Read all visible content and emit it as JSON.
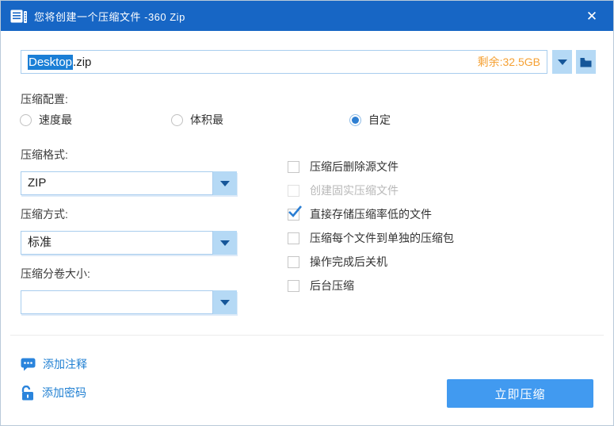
{
  "window": {
    "title": "您将创建一个压缩文件 -360 Zip",
    "close_glyph": "✕"
  },
  "filename": {
    "selected_part": "Desktop",
    "extension_part": ".zip",
    "free_space": "剩余:32.5GB"
  },
  "config": {
    "label": "压缩配置:",
    "options": [
      {
        "label": "速度最",
        "selected": false
      },
      {
        "label": "体积最",
        "selected": false
      },
      {
        "label": "自定",
        "selected": true
      }
    ]
  },
  "fields": [
    {
      "label": "压缩格式:",
      "value": "ZIP"
    },
    {
      "label": "压缩方式:",
      "value": "标准"
    },
    {
      "label": "压缩分卷大小:",
      "value": ""
    }
  ],
  "checkboxes": [
    {
      "label": "压缩后删除源文件",
      "checked": false,
      "disabled": false
    },
    {
      "label": "创建固实压缩文件",
      "checked": false,
      "disabled": true
    },
    {
      "label": "直接存储压缩率低的文件",
      "checked": true,
      "disabled": false
    },
    {
      "label": "压缩每个文件到单独的压缩包",
      "checked": false,
      "disabled": false
    },
    {
      "label": "操作完成后关机",
      "checked": false,
      "disabled": false
    },
    {
      "label": "后台压缩",
      "checked": false,
      "disabled": false
    }
  ],
  "footer": {
    "add_comment_label": "添加注释",
    "add_password_label": "添加密码",
    "compress_button_label": "立即压缩"
  },
  "colors": {
    "titlebar": "#1766c5",
    "selection": "#1b7fd6",
    "free_space_text": "#f5a033",
    "accent_button": "#419af0",
    "link": "#1f7fd2",
    "combo_button_bg": "#b5d9f5",
    "combo_border": "#a8cdee",
    "check_mark": "#2b7ed3"
  }
}
